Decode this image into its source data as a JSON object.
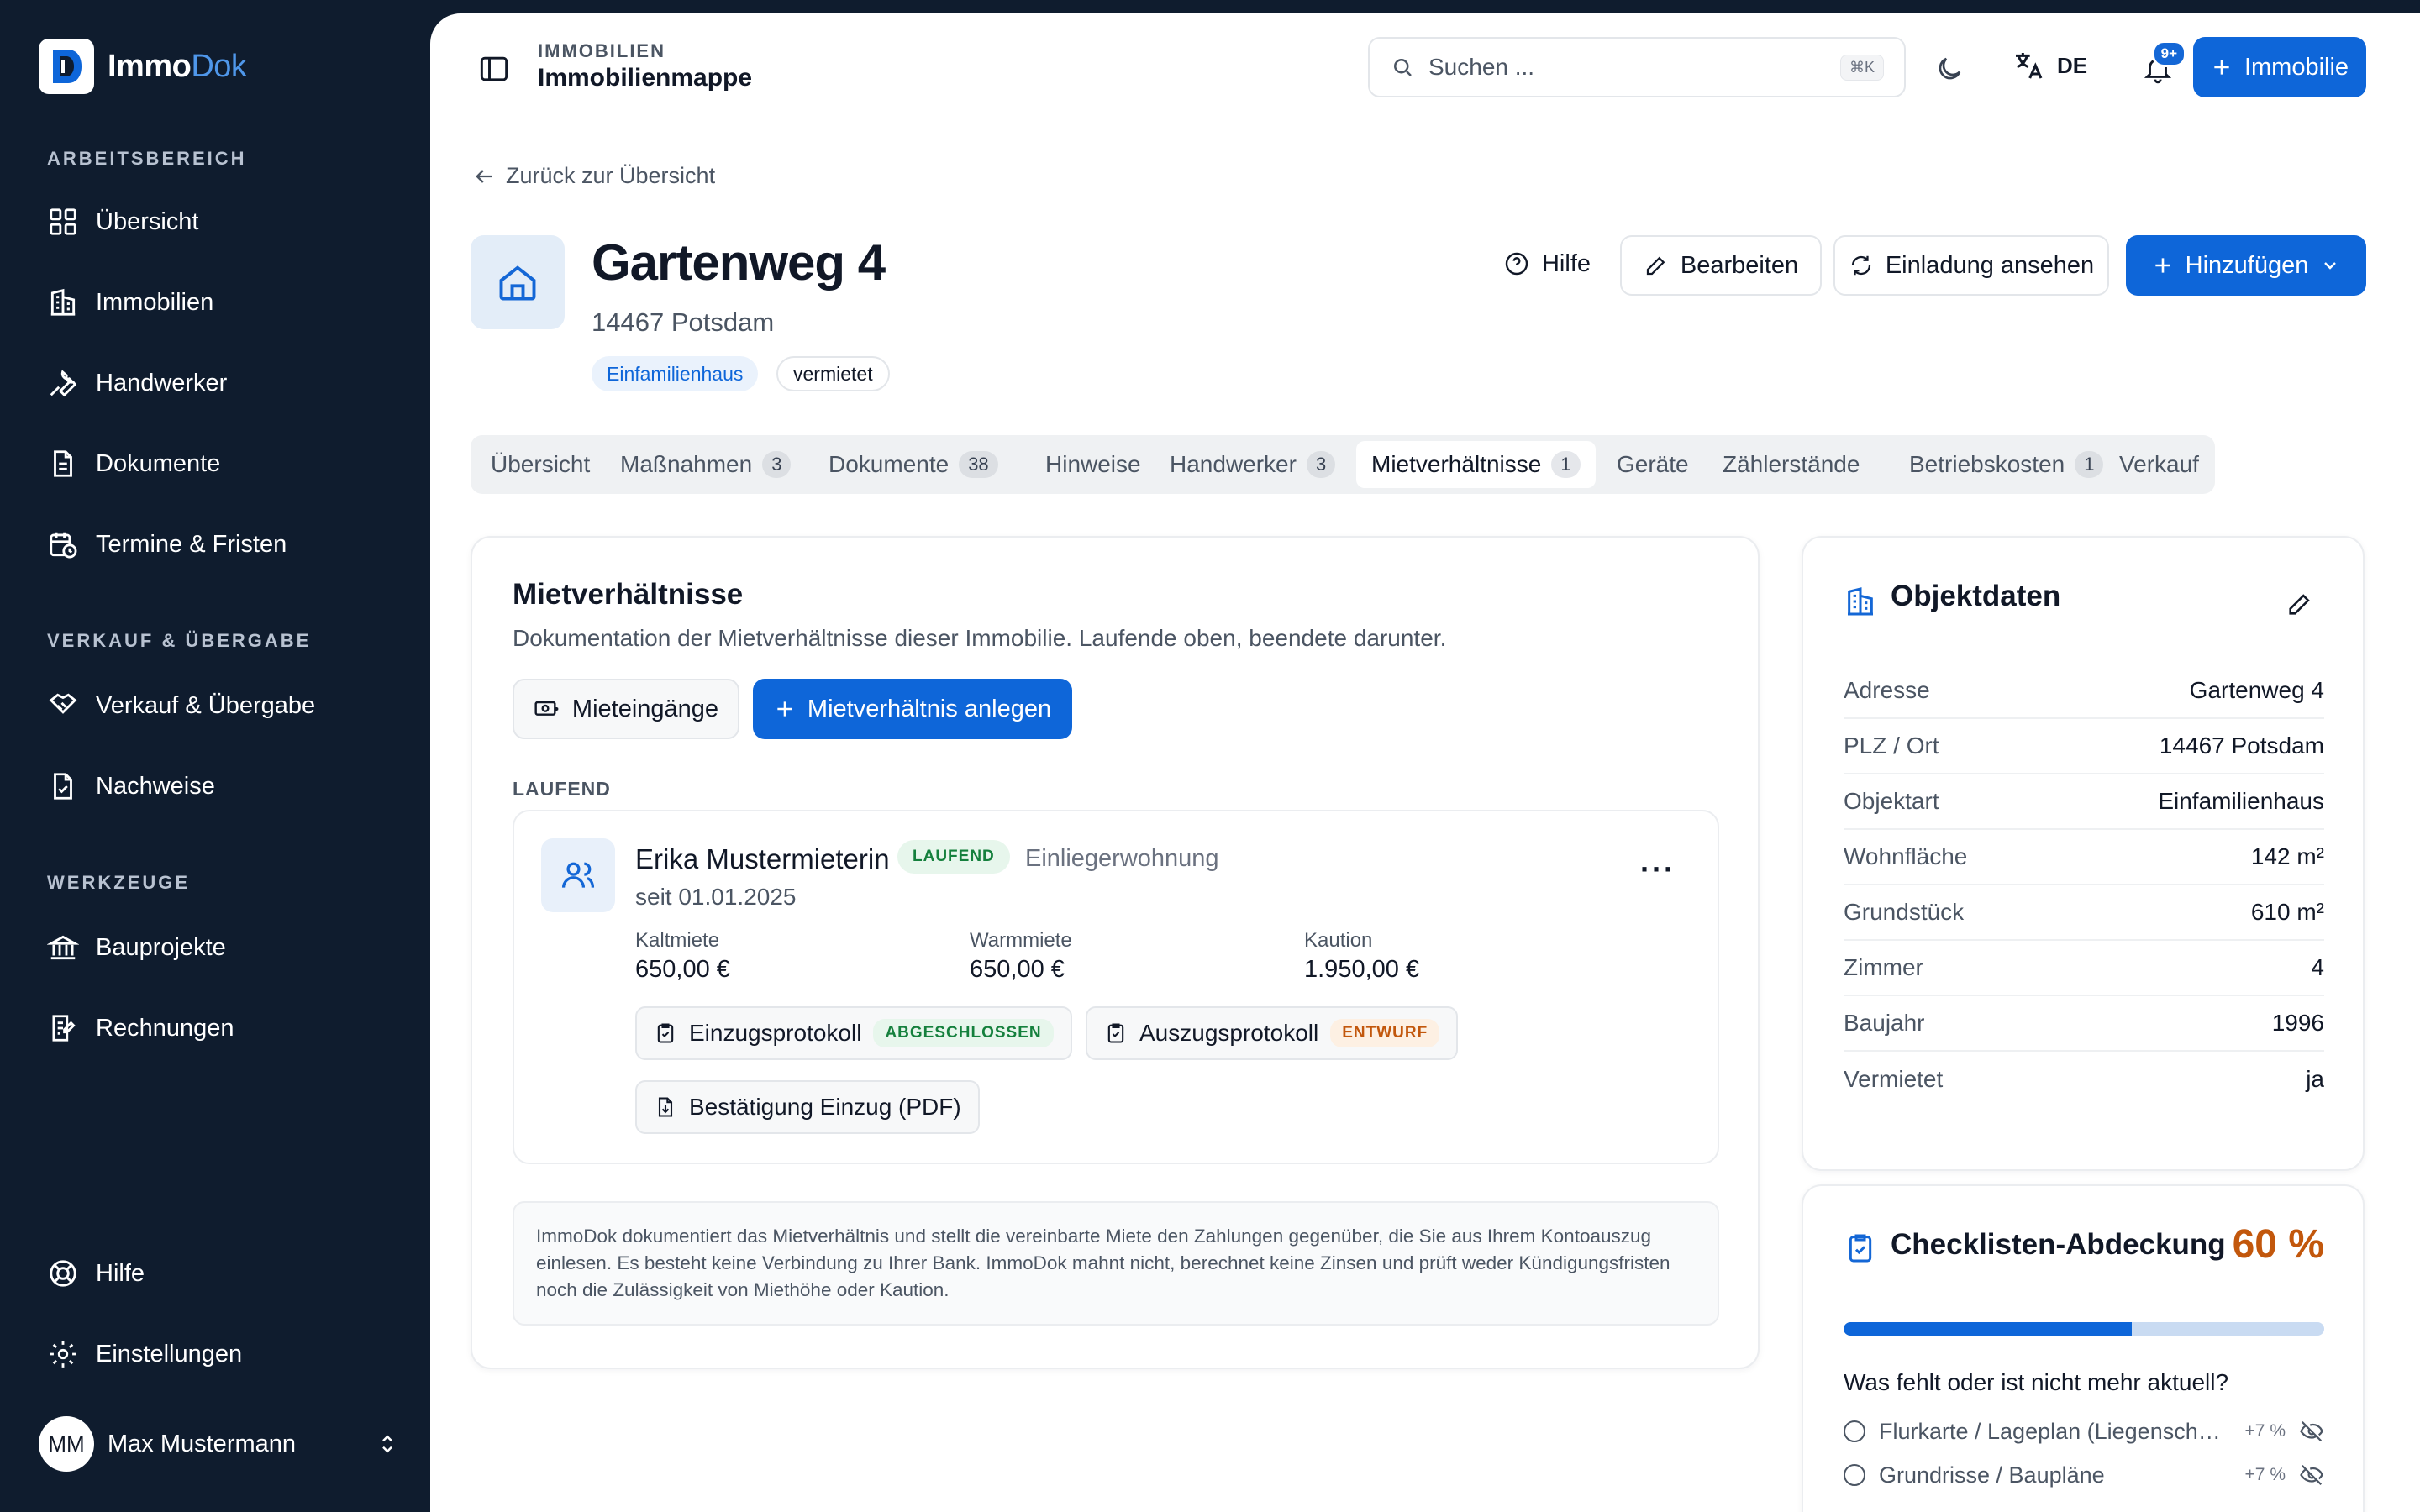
{
  "brand": {
    "name_a": "Immo",
    "name_b": "Dok"
  },
  "sidebar": {
    "sections": [
      {
        "label": "ARBEITSBEREICH"
      },
      {
        "label": "VERKAUF & ÜBERGABE"
      },
      {
        "label": "WERKZEUGE"
      }
    ],
    "items": [
      {
        "label": "Übersicht",
        "icon": "grid-icon"
      },
      {
        "label": "Immobilien",
        "icon": "buildings-icon"
      },
      {
        "label": "Handwerker",
        "icon": "wrench-icon"
      },
      {
        "label": "Dokumente",
        "icon": "document-icon"
      },
      {
        "label": "Termine & Fristen",
        "icon": "calendar-clock-icon"
      },
      {
        "label": "Verkauf & Übergabe",
        "icon": "handshake-icon"
      },
      {
        "label": "Nachweise",
        "icon": "file-check-icon"
      },
      {
        "label": "Bauprojekte",
        "icon": "bank-icon"
      },
      {
        "label": "Rechnungen",
        "icon": "receipt-icon"
      }
    ],
    "footer": [
      {
        "label": "Hilfe",
        "icon": "lifebuoy-icon"
      },
      {
        "label": "Einstellungen",
        "icon": "gear-icon"
      }
    ],
    "user": {
      "initials": "MM",
      "name": "Max Mustermann"
    }
  },
  "topbar": {
    "crumb_small": "IMMOBILIEN",
    "crumb_title": "Immobilienmappe",
    "search_placeholder": "Suchen ...",
    "search_shortcut": "⌘K",
    "language": "DE",
    "notification_badge": "9+",
    "add_button": "Immobilie"
  },
  "page": {
    "back_link": "Zurück zur Übersicht",
    "title": "Gartenweg 4",
    "subtitle": "14467 Potsdam",
    "tags": [
      "Einfamilienhaus",
      "vermietet"
    ],
    "actions": {
      "help": "Hilfe",
      "edit": "Bearbeiten",
      "invite": "Einladung ansehen",
      "add": "Hinzufügen"
    }
  },
  "tabs": [
    {
      "label": "Übersicht",
      "count": ""
    },
    {
      "label": "Maßnahmen",
      "count": "3"
    },
    {
      "label": "Dokumente",
      "count": "38"
    },
    {
      "label": "Hinweise",
      "count": ""
    },
    {
      "label": "Handwerker",
      "count": "3"
    },
    {
      "label": "Mietverhältnisse",
      "count": "1",
      "active": true
    },
    {
      "label": "Geräte",
      "count": ""
    },
    {
      "label": "Zählerstände",
      "count": ""
    },
    {
      "label": "Betriebskosten",
      "count": "1"
    },
    {
      "label": "Verkauf",
      "count": ""
    }
  ],
  "tenancies": {
    "title": "Mietverhältnisse",
    "description": "Dokumentation der Mietverhältnisse dieser Immobilie. Laufende oben, beendete darunter.",
    "btn_income": "Mieteingänge",
    "btn_create": "Mietverhältnis anlegen",
    "section_running": "LAUFEND",
    "tenant": {
      "name": "Erika Mustermieterin",
      "status": "LAUFEND",
      "unit": "Einliegerwohnung",
      "since": "seit 01.01.2025",
      "cold_rent_label": "Kaltmiete",
      "cold_rent": "650,00 €",
      "warm_rent_label": "Warmmiete",
      "warm_rent": "650,00 €",
      "deposit_label": "Kaution",
      "deposit": "1.950,00 €",
      "docs": [
        {
          "label": "Einzugsprotokoll",
          "status": "ABGESCHLOSSEN"
        },
        {
          "label": "Auszugsprotokoll",
          "status": "ENTWURF"
        },
        {
          "label": "Bestätigung Einzug (PDF)",
          "status": ""
        }
      ]
    },
    "note": "ImmoDok dokumentiert das Mietverhältnis und stellt die vereinbarte Miete den Zahlungen gegenüber, die Sie aus Ihrem Kontoauszug einlesen. Es besteht keine Verbindung zu Ihrer Bank. ImmoDok mahnt nicht, berechnet keine Zinsen und prüft weder Kündigungsfristen noch die Zulässigkeit von Miethöhe oder Kaution."
  },
  "object_data": {
    "title": "Objektdaten",
    "rows": [
      {
        "label": "Adresse",
        "value": "Gartenweg 4"
      },
      {
        "label": "PLZ / Ort",
        "value": "14467 Potsdam"
      },
      {
        "label": "Objektart",
        "value": "Einfamilienhaus"
      },
      {
        "label": "Wohnfläche",
        "value": "142 m²"
      },
      {
        "label": "Grundstück",
        "value": "610 m²"
      },
      {
        "label": "Zimmer",
        "value": "4"
      },
      {
        "label": "Baujahr",
        "value": "1996"
      },
      {
        "label": "Vermietet",
        "value": "ja"
      }
    ]
  },
  "checklist": {
    "title": "Checklisten-Abdeckung",
    "percent_label": "60 %",
    "progress": 0.6,
    "question": "Was fehlt oder ist nicht mehr aktuell?",
    "items": [
      {
        "label": "Flurkarte / Lageplan (Liegenschaftskarte)",
        "pct": "+7 %"
      },
      {
        "label": "Grundrisse / Baupläne",
        "pct": "+7 %"
      }
    ]
  },
  "colors": {
    "accent": "#0e66d9",
    "sidebar": "#0f1c2e",
    "percent": "#c2570c",
    "success": "#15803d",
    "warning": "#c2570c"
  }
}
